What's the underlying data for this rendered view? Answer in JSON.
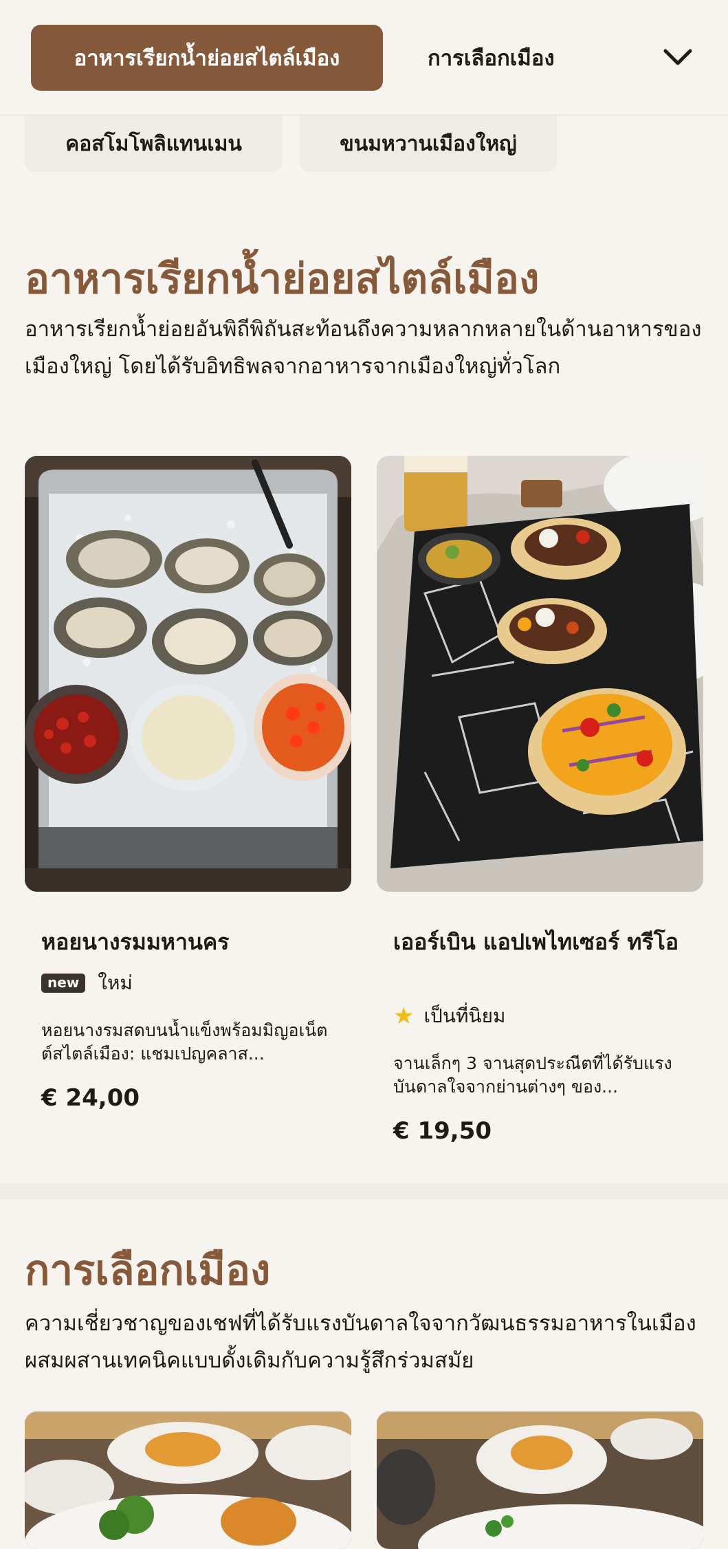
{
  "nav": {
    "active_tab": "อาหารเรียกน้ำย่อยสไตล์เมือง",
    "second_tab": "การเลือกเมือง",
    "dropdown_icon": "chevron-down-icon"
  },
  "chips": [
    "คอสโมโพลิแทนเมน",
    "ขนมหวานเมืองใหญ่"
  ],
  "section1": {
    "title": "อาหารเรียกน้ำย่อยสไตล์เมือง",
    "description": "อาหารเรียกน้ำย่อยอันพิถีพิถันสะท้อนถึงความหลากหลายในด้านอาหารของเมืองใหญ่ โดยได้รับอิทธิพลจากอาหารจากเมืองใหญ่ทั่วโลก",
    "items": [
      {
        "name": "หอยนางรมมหานคร",
        "badge": "new",
        "badge_label": "ใหม่",
        "description": "หอยนางรมสดบนน้ำแข็งพร้อมมิญอเน็ตต์สไตล์เมือง: แชมเปญคลาส...",
        "price": "€ 24,00"
      },
      {
        "name": "เออร์เบิน แอปเพไทเซอร์ ทรีโอ",
        "badge_icon": "star-icon",
        "badge_label": "เป็นที่นิยม",
        "description": "จานเล็กๆ 3 จานสุดประณีตที่ได้รับแรงบันดาลใจจากย่านต่างๆ ของ...",
        "price": "€ 19,50"
      }
    ]
  },
  "section2": {
    "title": "การเลือกเมือง",
    "description": "ความเชี่ยวชาญของเชฟที่ได้รับแรงบันดาลใจจากวัฒนธรรมอาหารในเมือง ผสมผสานเทคนิคแบบดั้งเดิมกับความรู้สึกร่วมสมัย"
  },
  "colors": {
    "accent": "#86593a",
    "background": "#f7f4ef",
    "chip": "#efebe5",
    "star": "#f1bd14"
  }
}
